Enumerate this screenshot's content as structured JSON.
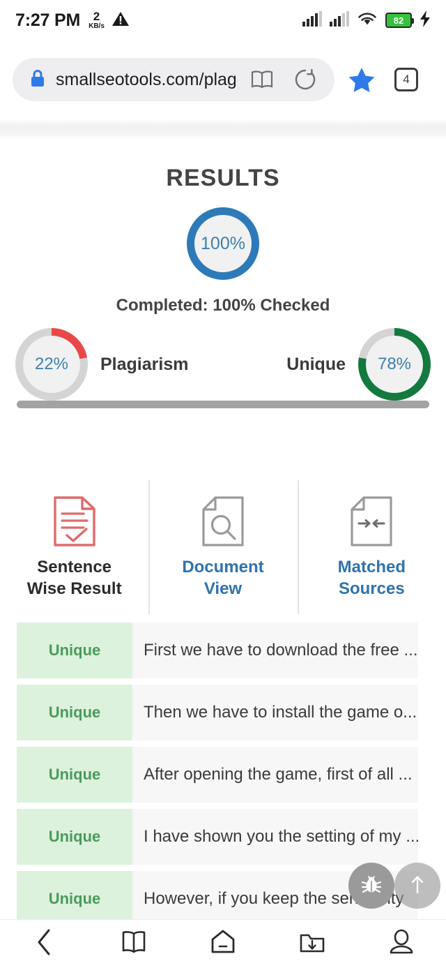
{
  "status_bar": {
    "time": "7:27 PM",
    "network_speed_value": "2",
    "network_speed_unit": "KB/s",
    "warning_icon": "warning-triangle-icon",
    "signal_icon_1": "signal-bars-icon",
    "signal_icon_2": "signal-bars-icon",
    "wifi_icon": "wifi-icon",
    "battery_level": "82",
    "charging_icon": "charging-bolt-icon"
  },
  "browser": {
    "lock_icon": "lock-icon",
    "url": "smallseotools.com/plagia",
    "reader_icon": "book-reader-icon",
    "reload_icon": "reload-icon",
    "bookmark_icon": "star-icon",
    "tab_count": "4"
  },
  "page": {
    "title": "RESULTS",
    "total_gauge": {
      "value": "100%",
      "percent": 100,
      "color": "#2e7ab8"
    },
    "completed_text": "Completed: 100% Checked",
    "plagiarism": {
      "value": "22%",
      "percent": 22,
      "label": "Plagiarism",
      "color": "#e8484a"
    },
    "unique": {
      "value": "78%",
      "percent": 78,
      "label": "Unique",
      "color": "#13793f"
    },
    "track_color": "#d4d4d4",
    "tabs": [
      {
        "label_line1": "Sentence",
        "label_line2": "Wise Result",
        "icon": "document-check-icon",
        "state": "active",
        "color": "#e06b6b"
      },
      {
        "label_line1": "Document",
        "label_line2": "View",
        "icon": "document-search-icon",
        "state": "link",
        "color": "#9a9a9a"
      },
      {
        "label_line1": "Matched",
        "label_line2": "Sources",
        "icon": "document-arrows-icon",
        "state": "link",
        "color": "#9a9a9a"
      }
    ],
    "sentences": [
      {
        "status": "Unique",
        "text": "First we have to download the free ..."
      },
      {
        "status": "Unique",
        "text": "Then we have to install the game o..."
      },
      {
        "status": "Unique",
        "text": "After opening the game, first of all ..."
      },
      {
        "status": "Unique",
        "text": "I have shown you the setting of my ..."
      },
      {
        "status": "Unique",
        "text": "However, if you keep the sensitivity"
      }
    ],
    "fab_bug_icon": "bug-icon",
    "fab_top_icon": "arrow-up-icon"
  },
  "bottom_nav": [
    {
      "icon": "back-chevron-icon"
    },
    {
      "icon": "bookmarks-book-icon"
    },
    {
      "icon": "home-icon"
    },
    {
      "icon": "downloads-icon"
    },
    {
      "icon": "profile-icon"
    }
  ]
}
